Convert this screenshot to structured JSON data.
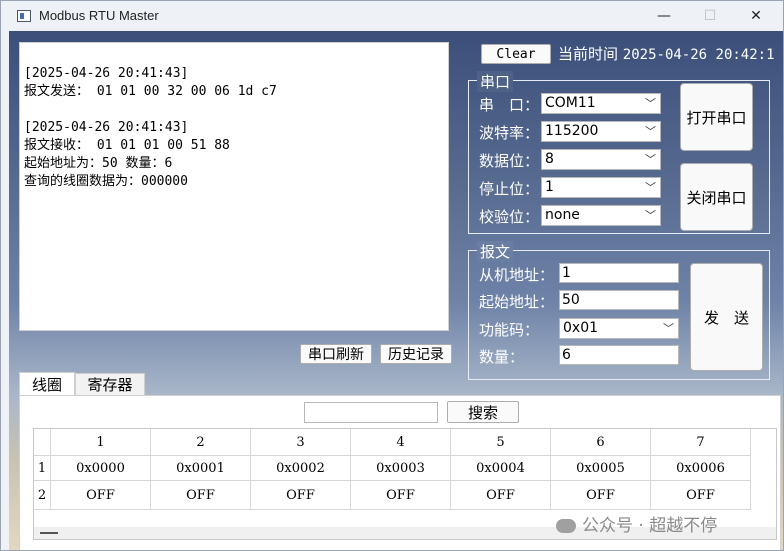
{
  "window": {
    "title": "Modbus RTU Master",
    "minimize": "—",
    "maximize": "☐",
    "close": "✕"
  },
  "log": {
    "text": "[2025-04-26 20:41:43]\n报文发送： 01 01 00 32 00 06 1d c7\n\n[2025-04-26 20:41:43]\n报文接收： 01 01 01 00 51 88\n起始地址为：50 数量：6\n查询的线圈数据为：000000"
  },
  "header": {
    "clear_label": "Clear",
    "time_label": "当前时间",
    "time_value": "2025-04-26 20:42:1"
  },
  "serial": {
    "group_title": "串口",
    "fields": [
      {
        "label": "串　口：",
        "value": "COM11"
      },
      {
        "label": "波特率：",
        "value": "115200"
      },
      {
        "label": "数据位：",
        "value": "8"
      },
      {
        "label": "停止位：",
        "value": "1"
      },
      {
        "label": "校验位：",
        "value": "none"
      }
    ],
    "open_label": "打开串口",
    "close_label": "关闭串口"
  },
  "message": {
    "group_title": "报文",
    "fields": [
      {
        "label": "从机地址：",
        "value": "1"
      },
      {
        "label": "起始地址：",
        "value": "50"
      },
      {
        "label": "功能码：",
        "value": "0x01"
      },
      {
        "label": "数量：",
        "value": "6"
      }
    ],
    "send_label": "发　送"
  },
  "buttons": {
    "refresh_label": "串口刷新",
    "history_label": "历史记录",
    "search_label": "搜索"
  },
  "tabs": [
    {
      "label": "线圈"
    },
    {
      "label": "寄存器"
    }
  ],
  "search": {
    "value": ""
  },
  "table": {
    "columns": [
      "1",
      "2",
      "3",
      "4",
      "5",
      "6",
      "7"
    ],
    "row_headers": [
      "1",
      "2"
    ],
    "rows": [
      [
        "0x0000",
        "0x0001",
        "0x0002",
        "0x0003",
        "0x0004",
        "0x0005",
        "0x0006"
      ],
      [
        "OFF",
        "OFF",
        "OFF",
        "OFF",
        "OFF",
        "OFF",
        "OFF"
      ]
    ]
  },
  "watermark": {
    "text": "公众号 · 超越不停"
  }
}
